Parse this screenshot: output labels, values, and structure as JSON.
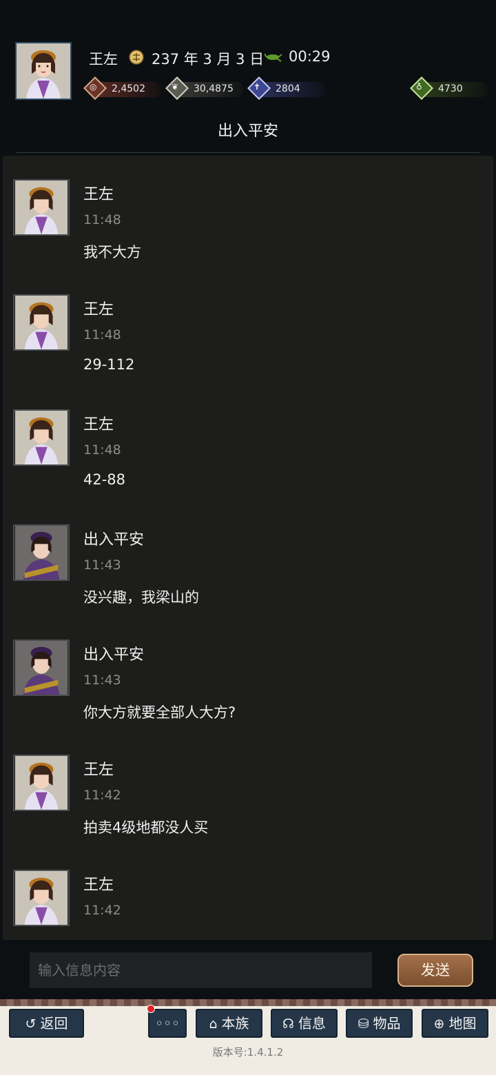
{
  "header": {
    "player_name": "王左",
    "date": "237 年 3 月 3 日",
    "time": "00:29",
    "page_title": "出入平安",
    "resources": [
      {
        "name": "coins",
        "icon": "coin-icon",
        "value": "2,4502",
        "color": "#5a2a22"
      },
      {
        "name": "grain",
        "icon": "grain-icon",
        "value": "30,4875",
        "color": "#3a3a36"
      },
      {
        "name": "soldiers",
        "icon": "soldier-icon",
        "value": "2804",
        "color": "#2a2f5a"
      },
      {
        "name": "money-bag",
        "icon": "money-bag-icon",
        "value": "4730",
        "color": "#2a3a1a"
      }
    ]
  },
  "chat": {
    "messages": [
      {
        "sender": "王左",
        "time": "11:48",
        "text": "我不大方",
        "avatar": "avatar-wangzuo"
      },
      {
        "sender": "王左",
        "time": "11:48",
        "text": "29-112",
        "avatar": "avatar-wangzuo"
      },
      {
        "sender": "王左",
        "time": "11:48",
        "text": "42-88",
        "avatar": "avatar-wangzuo"
      },
      {
        "sender": "出入平安",
        "time": "11:43",
        "text": "没兴趣，我梁山的",
        "avatar": "avatar-churupingan"
      },
      {
        "sender": "出入平安",
        "time": "11:43",
        "text": "你大方就要全部人大方?",
        "avatar": "avatar-churupingan"
      },
      {
        "sender": "王左",
        "time": "11:42",
        "text": "拍卖4级地都没人买",
        "avatar": "avatar-wangzuo"
      },
      {
        "sender": "王左",
        "time": "11:42",
        "text": "",
        "avatar": "avatar-wangzuo"
      }
    ]
  },
  "input": {
    "placeholder": "输入信息内容",
    "send_label": "发送"
  },
  "nav": {
    "back": "返回",
    "more": "◦◦◦",
    "clan": "本族",
    "info": "信息",
    "items": "物品",
    "map": "地图"
  },
  "version": "版本号:1.4.1.2"
}
